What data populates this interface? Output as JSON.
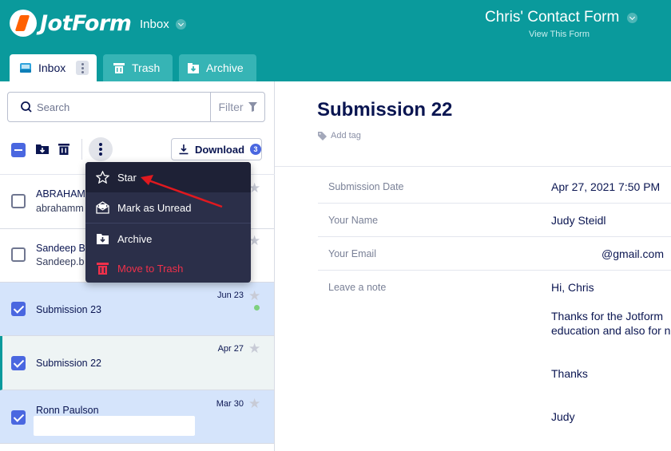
{
  "header": {
    "logo_text": "JotForm",
    "nav_label": "Inbox",
    "form_title": "Chris' Contact Form",
    "view_form_link": "View This Form"
  },
  "tabs": [
    {
      "label": "Inbox"
    },
    {
      "label": "Trash"
    },
    {
      "label": "Archive"
    }
  ],
  "search": {
    "placeholder": "Search",
    "filter_label": "Filter"
  },
  "toolbar": {
    "download_label": "Download",
    "download_count": "3"
  },
  "dropdown": {
    "items": [
      {
        "label": "Star",
        "icon": "star-outline-icon"
      },
      {
        "label": "Mark as Unread",
        "icon": "envelope-open-icon"
      },
      {
        "label": "Archive",
        "icon": "archive-icon"
      },
      {
        "label": "Move to Trash",
        "icon": "trash-icon"
      }
    ]
  },
  "submissions": [
    {
      "name": "ABRAHAM",
      "sub": "abrahamm",
      "date": "",
      "checked": false
    },
    {
      "name": "Sandeep B",
      "sub": "Sandeep.b",
      "date": "",
      "checked": false
    },
    {
      "name": "Submission 23",
      "sub": "",
      "date": "Jun 23",
      "checked": true
    },
    {
      "name": "Submission 22",
      "sub": "",
      "date": "Apr 27",
      "checked": true
    },
    {
      "name": "Ronn Paulson",
      "sub": "",
      "date": "Mar 30",
      "checked": true
    }
  ],
  "detail": {
    "title": "Submission 22",
    "add_tag": "Add tag",
    "fields": [
      {
        "label": "Submission Date",
        "value": "Apr 27, 2021 7:50 PM"
      },
      {
        "label": "Your Name",
        "value": "Judy Steidl"
      },
      {
        "label": "Your Email",
        "value": "@gmail.com"
      },
      {
        "label": "Leave a note",
        "value": "Hi, Chris"
      }
    ],
    "note_lines": [
      "Thanks for the Jotform",
      "education and also for n",
      "Thanks",
      "Judy"
    ]
  },
  "colors": {
    "header_bg": "#0a9a9c",
    "accent": "#4a67e0",
    "danger": "#f0304a",
    "annotation_arrow": "#e0191f"
  }
}
